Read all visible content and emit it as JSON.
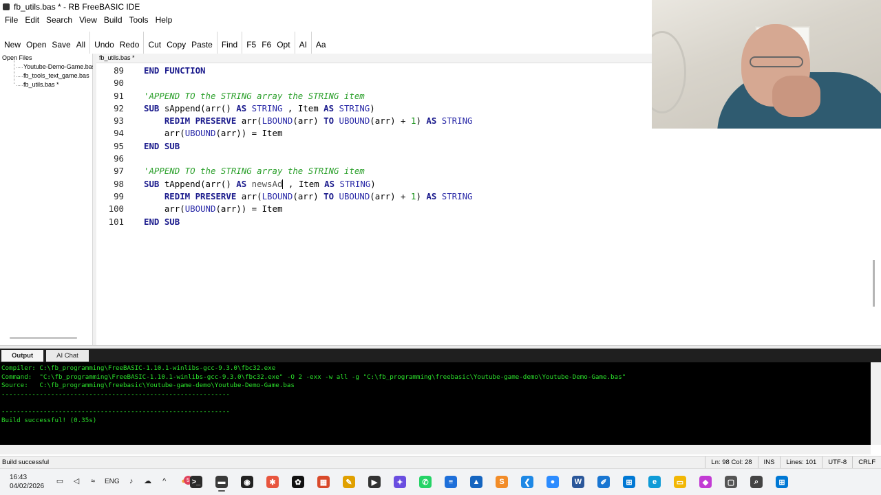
{
  "window": {
    "title": "fb_utils.bas * - RB FreeBASIC IDE"
  },
  "menu": [
    "File",
    "Edit",
    "Search",
    "View",
    "Build",
    "Tools",
    "Help"
  ],
  "toolbar": {
    "groups": [
      [
        "New",
        "Open",
        "Save",
        "All"
      ],
      [
        "Undo",
        "Redo"
      ],
      [
        "Cut",
        "Copy",
        "Paste"
      ],
      [
        "Find"
      ],
      [
        "F5",
        "F6",
        "Opt"
      ],
      [
        "AI"
      ],
      [
        "Aa"
      ]
    ]
  },
  "left_panel": {
    "title": "Open Files",
    "files": [
      "Youtube-Demo-Game.bas",
      "fb_tools_text_game.bas",
      "fb_utils.bas *"
    ]
  },
  "editor": {
    "tab": "fb_utils.bas *",
    "lines": [
      {
        "n": "89",
        "parts": [
          [
            "kw",
            "END FUNCTION"
          ]
        ]
      },
      {
        "n": "90",
        "parts": []
      },
      {
        "n": "91",
        "parts": [
          [
            "cm",
            "'APPEND TO the STRING array the STRING item"
          ]
        ]
      },
      {
        "n": "92",
        "parts": [
          [
            "kw",
            "SUB"
          ],
          [
            "fn",
            " sAppend(arr() "
          ],
          [
            "kw",
            "AS"
          ],
          [
            "kw2",
            " STRING"
          ],
          [
            "fn",
            " , Item "
          ],
          [
            "kw",
            "AS"
          ],
          [
            "kw2",
            " STRING"
          ],
          [
            "fn",
            ")"
          ]
        ]
      },
      {
        "n": "93",
        "parts": [
          [
            "fn",
            "    "
          ],
          [
            "kw",
            "REDIM PRESERVE"
          ],
          [
            "fn",
            " arr("
          ],
          [
            "kw2",
            "LBOUND"
          ],
          [
            "fn",
            "(arr) "
          ],
          [
            "kw",
            "TO"
          ],
          [
            "fn",
            " "
          ],
          [
            "kw2",
            "UBOUND"
          ],
          [
            "fn",
            "(arr) + "
          ],
          [
            "num",
            "1"
          ],
          [
            "fn",
            ") "
          ],
          [
            "kw",
            "AS"
          ],
          [
            "kw2",
            " STRING"
          ]
        ]
      },
      {
        "n": "94",
        "parts": [
          [
            "fn",
            "    arr("
          ],
          [
            "kw2",
            "UBOUND"
          ],
          [
            "fn",
            "(arr)) = Item"
          ]
        ]
      },
      {
        "n": "95",
        "parts": [
          [
            "kw",
            "END SUB"
          ]
        ]
      },
      {
        "n": "96",
        "parts": []
      },
      {
        "n": "97",
        "parts": [
          [
            "cm",
            "'APPEND TO the STRING array the STRING item"
          ]
        ]
      },
      {
        "n": "98",
        "parts": [
          [
            "kw",
            "SUB"
          ],
          [
            "fn",
            " tAppend(arr() "
          ],
          [
            "kw",
            "AS"
          ],
          [
            "dim",
            " newsAd"
          ],
          [
            "caret",
            ""
          ],
          [
            "fn",
            " , Item "
          ],
          [
            "kw",
            "AS"
          ],
          [
            "kw2",
            " STRING"
          ],
          [
            "fn",
            ")"
          ]
        ]
      },
      {
        "n": "99",
        "parts": [
          [
            "fn",
            "    "
          ],
          [
            "kw",
            "REDIM PRESERVE"
          ],
          [
            "fn",
            " arr("
          ],
          [
            "kw2",
            "LBOUND"
          ],
          [
            "fn",
            "(arr) "
          ],
          [
            "kw",
            "TO"
          ],
          [
            "fn",
            " "
          ],
          [
            "kw2",
            "UBOUND"
          ],
          [
            "fn",
            "(arr) + "
          ],
          [
            "num",
            "1"
          ],
          [
            "fn",
            ") "
          ],
          [
            "kw",
            "AS"
          ],
          [
            "kw2",
            " STRING"
          ]
        ]
      },
      {
        "n": "100",
        "parts": [
          [
            "fn",
            "    arr("
          ],
          [
            "kw2",
            "UBOUND"
          ],
          [
            "fn",
            "(arr)) = Item"
          ]
        ]
      },
      {
        "n": "101",
        "parts": [
          [
            "kw",
            "END SUB"
          ]
        ]
      }
    ]
  },
  "output": {
    "tabs": [
      "Output",
      "AI Chat"
    ],
    "active_tab": "Output",
    "lines": [
      "Compiler: C:\\fb_programming\\FreeBASIC-1.10.1-winlibs-gcc-9.3.0\\fbc32.exe",
      "Command:  \"C:\\fb_programming\\FreeBASIC-1.10.1-winlibs-gcc-9.3.0\\fbc32.exe\" -O 2 -exx -w all -g \"C:\\fb_programming\\freebasic\\Youtube-game-demo\\Youtube-Demo-Game.bas\"",
      "Source:   C:\\fb_programming\\freebasic\\Youtube-game-demo\\Youtube-Demo-Game.bas",
      "------------------------------------------------------------",
      "",
      "------------------------------------------------------------",
      "Build successful! (0.35s)"
    ]
  },
  "status": {
    "message": "Build successful",
    "position": "Ln: 98 Col: 28",
    "mode": "INS",
    "lines": "Lines: 101",
    "encoding": "UTF-8",
    "eol": "CRLF"
  },
  "taskbar": {
    "time": "16:43",
    "date": "04/02/2026",
    "lang": "ENG",
    "notification_count": "5",
    "apps": [
      {
        "icon": "terminal-icon",
        "color": "#2b2b2b",
        "glyph": ">_"
      },
      {
        "icon": "ide-icon",
        "color": "#3a3a3a",
        "glyph": "▬",
        "active": true
      },
      {
        "icon": "obs-icon",
        "color": "#222222",
        "glyph": "◉"
      },
      {
        "icon": "star-app-icon",
        "color": "#e8553e",
        "glyph": "✱"
      },
      {
        "icon": "chatgpt-icon",
        "color": "#111111",
        "glyph": "✿"
      },
      {
        "icon": "puzzle-app-icon",
        "color": "#d94a2b",
        "glyph": "▦"
      },
      {
        "icon": "pen-app-icon",
        "color": "#e0a000",
        "glyph": "✎"
      },
      {
        "icon": "media-player-icon",
        "color": "#333333",
        "glyph": "▶"
      },
      {
        "icon": "copilot-icon",
        "color": "#6a4ee0",
        "glyph": "✦"
      },
      {
        "icon": "whatsapp-icon",
        "color": "#25d366",
        "glyph": "✆"
      },
      {
        "icon": "docs-icon",
        "color": "#1e6fd9",
        "glyph": "≡"
      },
      {
        "icon": "photos-icon",
        "color": "#1565c0",
        "glyph": "▲"
      },
      {
        "icon": "sublime-icon",
        "color": "#f28c28",
        "glyph": "S"
      },
      {
        "icon": "vscode-icon",
        "color": "#1e88e5",
        "glyph": "❮"
      },
      {
        "icon": "zoom-icon",
        "color": "#2d8cff",
        "glyph": "●"
      },
      {
        "icon": "word-icon",
        "color": "#2b579a",
        "glyph": "W"
      },
      {
        "icon": "edit-app-icon",
        "color": "#1976d2",
        "glyph": "✐"
      },
      {
        "icon": "store-icon",
        "color": "#0078d4",
        "glyph": "⊞"
      },
      {
        "icon": "edge-icon",
        "color": "#0f9bd7",
        "glyph": "e"
      },
      {
        "icon": "folder-icon",
        "color": "#f2b705",
        "glyph": "▭"
      },
      {
        "icon": "m365-icon",
        "color": "#c23bd4",
        "glyph": "◆"
      },
      {
        "icon": "window-icon",
        "color": "#555555",
        "glyph": "▢"
      },
      {
        "icon": "search-icon",
        "color": "#444444",
        "glyph": "⌕"
      },
      {
        "icon": "start-icon",
        "color": "#0078d4",
        "glyph": "⊞"
      }
    ]
  }
}
